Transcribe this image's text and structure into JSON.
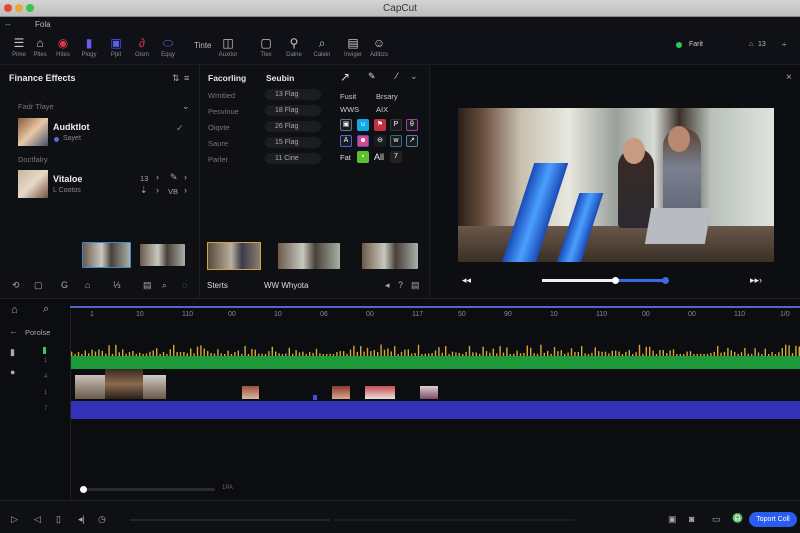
{
  "window": {
    "title": "CapCut"
  },
  "menu": {
    "item": "Fola"
  },
  "toolbar": {
    "items": [
      {
        "label": "Pime",
        "icon": "layers-icon",
        "glyph": "☰",
        "color": "#c8c8c8"
      },
      {
        "label": "Pltes",
        "icon": "home-icon",
        "glyph": "⌂",
        "color": "#c8c8c8"
      },
      {
        "label": "Hites",
        "icon": "coin-icon",
        "glyph": "◉",
        "color": "#e0364a"
      },
      {
        "label": "Plogy",
        "icon": "bars-icon",
        "glyph": "▮",
        "color": "#6a5cf0"
      },
      {
        "label": "Ppit",
        "icon": "frame-icon",
        "glyph": "▣",
        "color": "#5060f0"
      },
      {
        "label": "Oism",
        "icon": "link-icon",
        "glyph": "∂",
        "color": "#e03050"
      },
      {
        "label": "Eqqy",
        "icon": "tag-icon",
        "glyph": "⬭",
        "color": "#5a6cf0"
      },
      {
        "label": "Auxtior",
        "icon": "panel-icon",
        "glyph": "◫",
        "color": "#c8c8c8"
      },
      {
        "label": "Tlex",
        "icon": "folder-icon",
        "glyph": "▢",
        "color": "#c8c8c8"
      },
      {
        "label": "Dalne",
        "icon": "pin-icon",
        "glyph": "⚲",
        "color": "#c8c8c8"
      },
      {
        "label": "Calein",
        "icon": "search-icon",
        "glyph": "⌕",
        "color": "#c8c8c8"
      },
      {
        "label": "Inviger",
        "icon": "document-icon",
        "glyph": "▤",
        "color": "#c8c8c8"
      },
      {
        "label": "Adibzs",
        "icon": "smiley-icon",
        "glyph": "☺",
        "color": "#c8c8c8"
      }
    ],
    "text_label": "Tinte",
    "status": "Farit",
    "status_color": "#2ecc55",
    "counter": "13"
  },
  "left_panel": {
    "title": "Finance Effects",
    "section1": "Fadr Tlaye",
    "item1": {
      "name": "Audktlot",
      "sub": "Sayet"
    },
    "section2": "Doctfalry",
    "item2": {
      "name": "Vitaloe",
      "sub": "L Cootos",
      "meta1": "13",
      "meta2": "VB"
    }
  },
  "mid_panel": {
    "col1": "Facorling",
    "col2": "Seubin",
    "rows": [
      {
        "label": "Wmitied",
        "value": "13 Flag"
      },
      {
        "label": "Pesvinue",
        "value": "18 Flag"
      },
      {
        "label": "Oiqvte",
        "value": "26 Flag"
      },
      {
        "label": "Saure",
        "value": "15 Flag"
      },
      {
        "label": "Parler",
        "value": "11 Cine"
      }
    ],
    "tags": [
      "Fusit",
      "Brsary",
      "WWS",
      "AIX"
    ],
    "last_row": [
      "Fat",
      "All",
      "7"
    ],
    "footer_left": "Sterts",
    "footer_mid": "WW Whyota"
  },
  "timeline": {
    "ruler": [
      "1",
      "10",
      "110",
      "00",
      "10",
      "06",
      "00",
      "117",
      "50",
      "90",
      "10",
      "110",
      "00",
      "00",
      "110",
      "1/0"
    ],
    "left": {
      "back_label": "Porolse",
      "tracks": [
        "1",
        "4",
        "1",
        "7"
      ]
    },
    "zoom_label": "1PA"
  },
  "player": {
    "progress": 0.59,
    "volume": 0.8
  },
  "bottombar": {
    "export_label": "Toport Coll",
    "accent": "#2b5cf0"
  }
}
